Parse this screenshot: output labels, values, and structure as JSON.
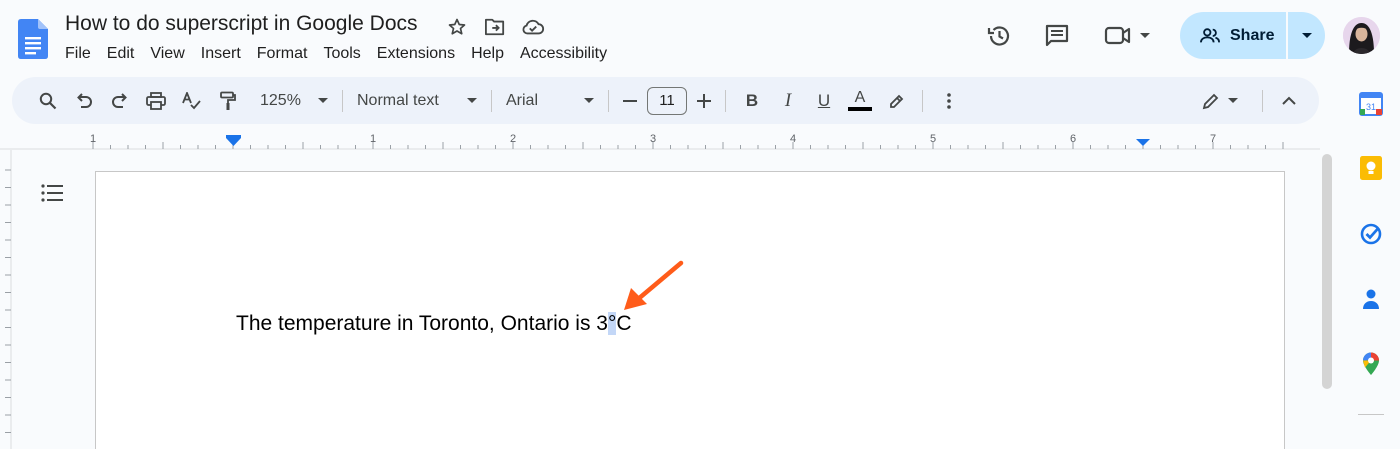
{
  "document": {
    "title": "How to do superscript in Google Docs",
    "body_text_before": "The temperature in Toronto, Ontario is 3",
    "body_text_selected": "°",
    "body_text_after": "C"
  },
  "menu": [
    "File",
    "Edit",
    "View",
    "Insert",
    "Format",
    "Tools",
    "Extensions",
    "Help",
    "Accessibility"
  ],
  "share": {
    "label": "Share"
  },
  "toolbar": {
    "zoom": "125%",
    "style": "Normal text",
    "font": "Arial",
    "font_size": "11",
    "bold_label": "B",
    "italic_label": "I",
    "underline_label": "U",
    "text_color_label": "A"
  },
  "ruler": {
    "labels": [
      "1",
      "1",
      "2",
      "3",
      "4",
      "5",
      "6",
      "7"
    ]
  },
  "icons": {
    "title": [
      "star-icon",
      "move-to-folder-icon",
      "cloud-status-icon"
    ],
    "header": [
      "version-history-icon",
      "comments-icon",
      "meet-icon"
    ],
    "side_panel": [
      "calendar-icon",
      "keep-icon",
      "tasks-icon",
      "contacts-icon",
      "maps-icon"
    ]
  },
  "colors": {
    "accent": "#1a73e8",
    "share_bg": "#c2e7ff",
    "toolbar_bg": "#edf2fa",
    "selection": "#c3d7f7",
    "arrow": "#ff5c1a"
  }
}
